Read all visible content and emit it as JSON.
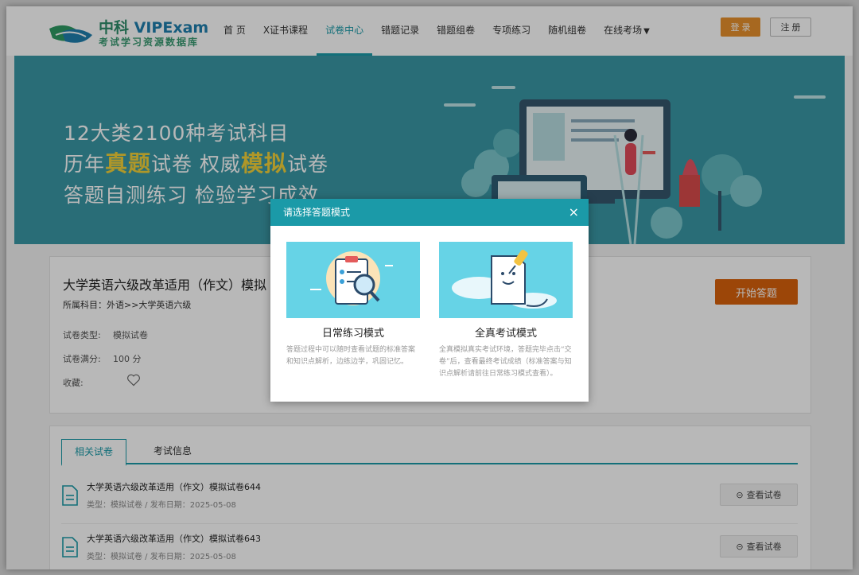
{
  "header": {
    "logo_title_cn": "中科",
    "logo_title_en": "VIPExam",
    "logo_subtitle": "考试学习资源数据库",
    "nav": [
      {
        "label": "首 页",
        "active": false
      },
      {
        "label": "X证书课程",
        "active": false
      },
      {
        "label": "试卷中心",
        "active": true
      },
      {
        "label": "错题记录",
        "active": false
      },
      {
        "label": "错题组卷",
        "active": false
      },
      {
        "label": "专项练习",
        "active": false
      },
      {
        "label": "随机组卷",
        "active": false
      },
      {
        "label": "在线考场",
        "active": false,
        "dropdown": true
      }
    ],
    "login_label": "登 录",
    "register_label": "注 册"
  },
  "banner": {
    "line1": "12大类2100种考试科目",
    "line2_a": "历年",
    "line2_b": "真题",
    "line2_c": "试卷 权威",
    "line2_d": "模拟",
    "line2_e": "试卷",
    "line3": "答题自测练习 检验学习成效"
  },
  "paper": {
    "title": "大学英语六级改革适用（作文）模拟",
    "subject": "所属科目：外语>>大学英语六级",
    "type_label": "试卷类型:",
    "type_value": "模拟试卷",
    "score_label": "试卷满分:",
    "score_value": "100 分",
    "fav_label": "收藏:",
    "start_label": "开始答题"
  },
  "tabs": [
    {
      "label": "相关试卷",
      "active": true
    },
    {
      "label": "考试信息",
      "active": false
    }
  ],
  "related": [
    {
      "title": "大学英语六级改革适用（作文）模拟试卷644",
      "meta": "类型：模拟试卷 / 发布日期：2025-05-08",
      "button": "查看试卷"
    },
    {
      "title": "大学英语六级改革适用（作文）模拟试卷643",
      "meta": "类型：模拟试卷 / 发布日期：2025-05-08",
      "button": "查看试卷"
    }
  ],
  "modal": {
    "title": "请选择答题模式",
    "close": "×",
    "modes": [
      {
        "name": "日常练习模式",
        "desc": "答题过程中可以随时查看试题的标准答案和知识点解析，边练边学，巩固记忆。"
      },
      {
        "name": "全真考试模式",
        "desc": "全真模拟真实考试环境，答题完毕点击“交卷”后，查看最终考试成绩（标准答案与知识点解析请前往日常练习模式查看）。"
      }
    ]
  },
  "colors": {
    "accent": "#1b9aa8",
    "banner": "#3a98a6",
    "highlight": "#f3d23a",
    "start_button": "#d9620c",
    "login_button": "#e8912d"
  }
}
